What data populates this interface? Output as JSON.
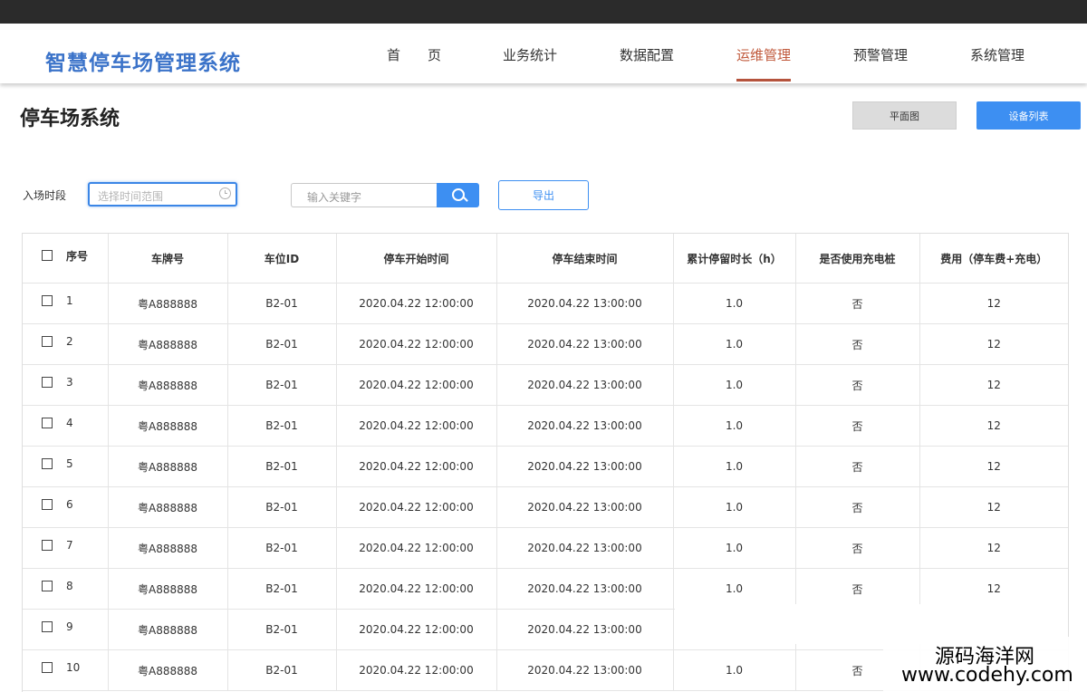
{
  "app": {
    "brand": "智慧停车场管理系统"
  },
  "nav": {
    "items": [
      {
        "label": "首　　页"
      },
      {
        "label": "业务统计"
      },
      {
        "label": "数据配置"
      },
      {
        "label": "运维管理",
        "active": true
      },
      {
        "label": "预警管理"
      },
      {
        "label": "系统管理"
      }
    ]
  },
  "page": {
    "title": "停车场系统"
  },
  "toolbar": {
    "plan_label": "平面图",
    "device_label": "设备列表"
  },
  "filter": {
    "entry_label": "入场时段",
    "date_placeholder": "选择时间范围",
    "keyword_placeholder": "输入关键字",
    "export_label": "导出"
  },
  "table": {
    "headers": [
      "序号",
      "车牌号",
      "车位ID",
      "停车开始时间",
      "停车结束时间",
      "累计停留时长（h）",
      "是否使用充电桩",
      "费用（停车费+充电）"
    ],
    "rows": [
      {
        "index": "1",
        "plate": "粤A888888",
        "slot": "B2-01",
        "start": "2020.04.22 12:00:00",
        "end": "2020.04.22 13:00:00",
        "duration": "1.0",
        "charging": "否",
        "fee": "12"
      },
      {
        "index": "2",
        "plate": "粤A888888",
        "slot": "B2-01",
        "start": "2020.04.22 12:00:00",
        "end": "2020.04.22 13:00:00",
        "duration": "1.0",
        "charging": "否",
        "fee": "12"
      },
      {
        "index": "3",
        "plate": "粤A888888",
        "slot": "B2-01",
        "start": "2020.04.22 12:00:00",
        "end": "2020.04.22 13:00:00",
        "duration": "1.0",
        "charging": "否",
        "fee": "12"
      },
      {
        "index": "4",
        "plate": "粤A888888",
        "slot": "B2-01",
        "start": "2020.04.22 12:00:00",
        "end": "2020.04.22 13:00:00",
        "duration": "1.0",
        "charging": "否",
        "fee": "12"
      },
      {
        "index": "5",
        "plate": "粤A888888",
        "slot": "B2-01",
        "start": "2020.04.22 12:00:00",
        "end": "2020.04.22 13:00:00",
        "duration": "1.0",
        "charging": "否",
        "fee": "12"
      },
      {
        "index": "6",
        "plate": "粤A888888",
        "slot": "B2-01",
        "start": "2020.04.22 12:00:00",
        "end": "2020.04.22 13:00:00",
        "duration": "1.0",
        "charging": "否",
        "fee": "12"
      },
      {
        "index": "7",
        "plate": "粤A888888",
        "slot": "B2-01",
        "start": "2020.04.22 12:00:00",
        "end": "2020.04.22 13:00:00",
        "duration": "1.0",
        "charging": "否",
        "fee": "12"
      },
      {
        "index": "8",
        "plate": "粤A888888",
        "slot": "B2-01",
        "start": "2020.04.22 12:00:00",
        "end": "2020.04.22 13:00:00",
        "duration": "1.0",
        "charging": "否",
        "fee": "12"
      },
      {
        "index": "9",
        "plate": "粤A888888",
        "slot": "B2-01",
        "start": "2020.04.22 12:00:00",
        "end": "2020.04.22 13:00:00",
        "duration": "",
        "charging": "",
        "fee": ""
      },
      {
        "index": "10",
        "plate": "粤A888888",
        "slot": "B2-01",
        "start": "2020.04.22 12:00:00",
        "end": "2020.04.22 13:00:00",
        "duration": "1.0",
        "charging": "否",
        "fee": ""
      }
    ]
  },
  "watermark": {
    "line1": "源码海洋网",
    "line2": "www.codehy.com"
  }
}
